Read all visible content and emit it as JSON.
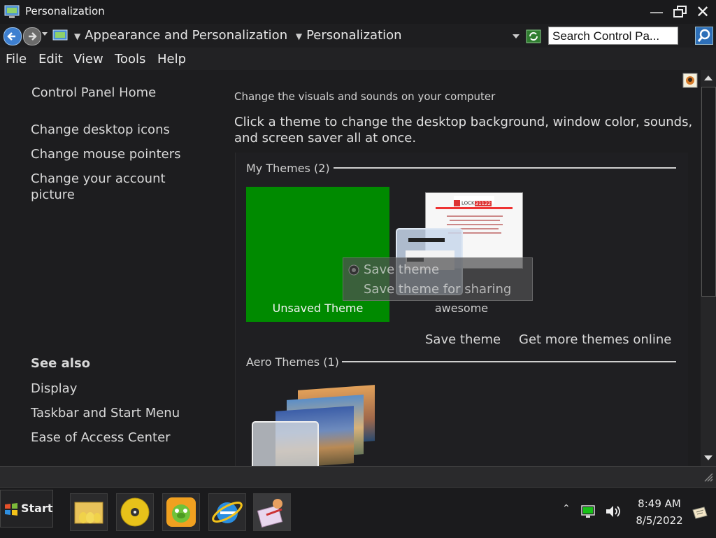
{
  "window": {
    "title": "Personalization"
  },
  "address": {
    "crumb1": "Appearance and Personalization",
    "crumb2": "Personalization",
    "search_placeholder": "Search Control Pa..."
  },
  "menu": {
    "file": "File",
    "edit": "Edit",
    "view": "View",
    "tools": "Tools",
    "help": "Help"
  },
  "sidebar": {
    "home": "Control Panel Home",
    "links": [
      "Change desktop icons",
      "Change mouse pointers",
      "Change your account",
      "picture"
    ],
    "see_also_title": "See also",
    "see_also": [
      "Display",
      "Taskbar and Start Menu",
      "Ease of Access Center"
    ]
  },
  "main": {
    "subtitle": "Change the visuals and sounds on your computer",
    "description_line1": "Click a theme to change the desktop background, window color, sounds,",
    "description_line2": "and screen saver all at once.",
    "my_themes_title": "My Themes (2)",
    "unsaved_theme": "Unsaved Theme",
    "awesome_theme": "awesome",
    "save_theme": "Save theme",
    "get_more": "Get more themes online",
    "aero_title": "Aero Themes (1)",
    "lock_text": "LOCK",
    "lock_code": "31122"
  },
  "context_menu": {
    "item1": "Save theme",
    "item2": "Save theme for sharing"
  },
  "taskbar": {
    "start": "Start",
    "time": "8:49 AM",
    "date": "8/5/2022"
  },
  "colors": {
    "unsaved_theme_bg": "#008a00",
    "background": "#1c1c1e"
  }
}
